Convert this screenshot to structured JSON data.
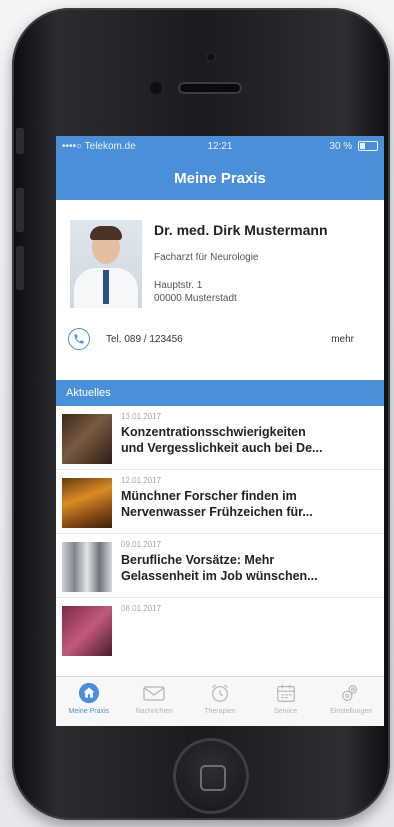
{
  "status_bar": {
    "carrier": "••••○ Telekom.de",
    "time": "12:21",
    "battery": "30 %"
  },
  "nav": {
    "title": "Meine Praxis"
  },
  "profile": {
    "name": "Dr. med. Dirk Mustermann",
    "specialty": "Facharzt für Neurologie",
    "address_line1": "Hauptstr. 1",
    "address_line2": "00000 Musterstadt",
    "phone": "Tel. 089 / 123456",
    "more_label": "mehr"
  },
  "section": {
    "title": "Aktuelles"
  },
  "news": [
    {
      "date": "13.01.2017",
      "title_line1": "Konzentrationsschwierigkeiten",
      "title_line2": "und Vergesslichkeit auch bei De..."
    },
    {
      "date": "12.01.2017",
      "title_line1": "Münchner Forscher finden im",
      "title_line2": "Nervenwasser Frühzeichen für..."
    },
    {
      "date": "09.01.2017",
      "title_line1": "Berufliche Vorsätze: Mehr",
      "title_line2": "Gelassenheit im Job wünschen..."
    },
    {
      "date": "08.01.2017",
      "title_line1": "",
      "title_line2": ""
    }
  ],
  "tabs": [
    {
      "label": "Meine Praxis",
      "icon": "home-icon",
      "active": true
    },
    {
      "label": "Nachrichten",
      "icon": "envelope-icon",
      "active": false
    },
    {
      "label": "Therapien",
      "icon": "alarm-clock-icon",
      "active": false
    },
    {
      "label": "Service",
      "icon": "calendar-icon",
      "active": false
    },
    {
      "label": "Einstellungen",
      "icon": "gear-icon",
      "active": false
    }
  ],
  "colors": {
    "accent": "#4a90d9",
    "tab_inactive": "#b5b5b5",
    "phone_body": "#1a1b1e"
  }
}
